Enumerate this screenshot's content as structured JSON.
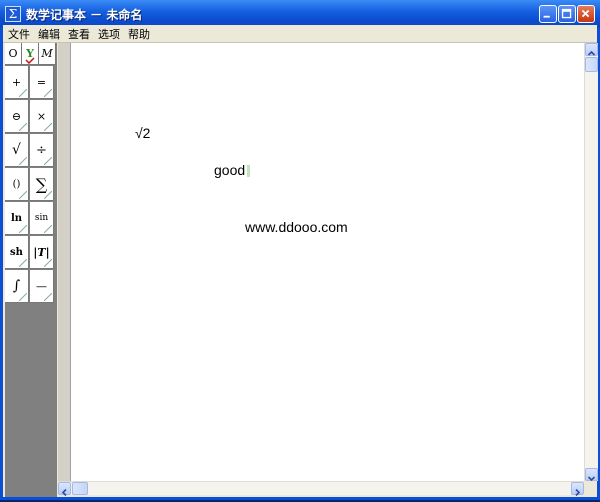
{
  "window": {
    "title": "数学记事本 － 未命名",
    "app_icon": "Σ"
  },
  "menu": [
    {
      "label": "文件"
    },
    {
      "label": "编辑"
    },
    {
      "label": "查看"
    },
    {
      "label": "选项"
    },
    {
      "label": "帮助"
    }
  ],
  "palette": {
    "items": [
      {
        "label": "O"
      },
      {
        "label": "Y"
      },
      {
        "label": "M"
      },
      {
        "label": "+"
      },
      {
        "label": "="
      },
      {
        "label": "⊖"
      },
      {
        "label": "×"
      },
      {
        "label": "√"
      },
      {
        "label": "÷"
      },
      {
        "label": "()"
      },
      {
        "label": "∑"
      },
      {
        "label": "ln"
      },
      {
        "label": "sin"
      },
      {
        "label": "sh"
      },
      {
        "label": "|T|"
      },
      {
        "label": "∫"
      },
      {
        "label": "—"
      }
    ]
  },
  "document": {
    "items": [
      {
        "text": "√2"
      },
      {
        "text": "good"
      },
      {
        "text": "www.ddooo.com"
      }
    ]
  }
}
